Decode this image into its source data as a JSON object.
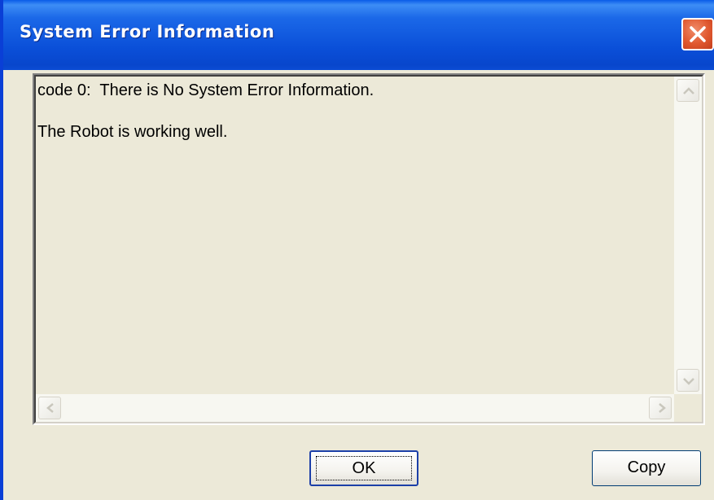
{
  "window": {
    "title": "System Error Information"
  },
  "message": {
    "lines": [
      "code 0:  There is No System Error Information.",
      "The Robot is working well."
    ]
  },
  "buttons": {
    "ok_label": "OK",
    "copy_label": "Copy"
  },
  "icons": {
    "close": "close-icon",
    "scroll_up": "chevron-up-icon",
    "scroll_down": "chevron-down-icon",
    "scroll_left": "chevron-left-icon",
    "scroll_right": "chevron-right-icon"
  },
  "colors": {
    "titlebar": "#0a4fd8",
    "close_button": "#e0582f",
    "dialog_background": "#ece9d8"
  }
}
